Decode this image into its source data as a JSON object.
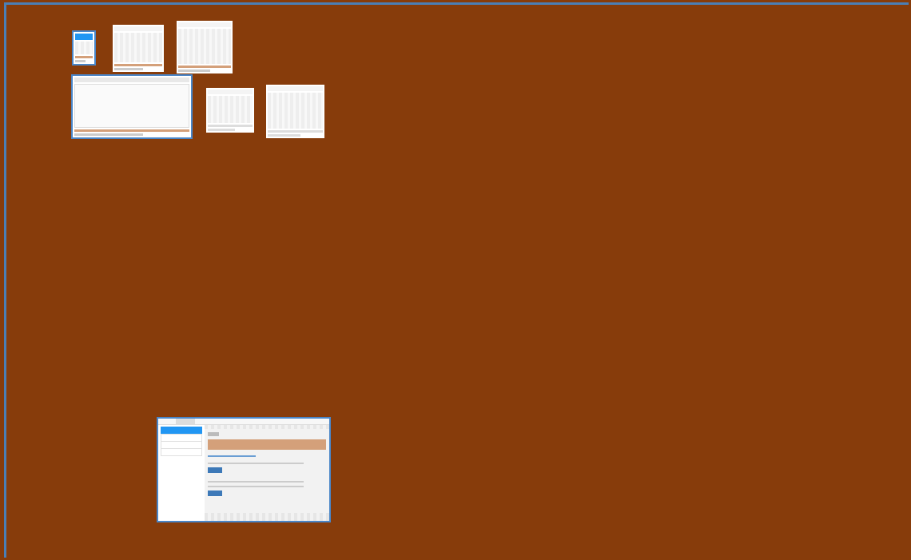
{
  "thumbnails": [
    {
      "kind": "phone"
    },
    {
      "kind": "dialog"
    },
    {
      "kind": "dialog"
    },
    {
      "kind": "window"
    },
    {
      "kind": "form"
    },
    {
      "kind": "form"
    },
    {
      "kind": "settings"
    }
  ]
}
